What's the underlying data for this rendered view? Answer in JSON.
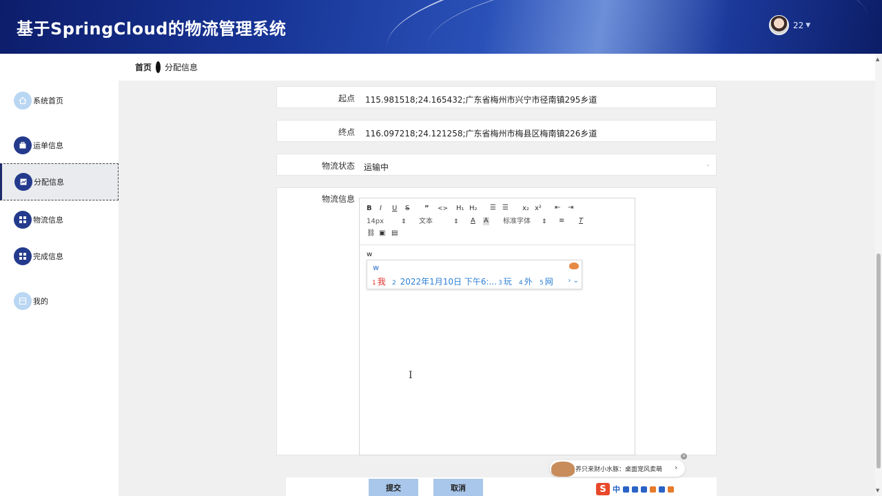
{
  "app": {
    "title": "基于SpringCloud的物流管理系统"
  },
  "user": {
    "name": "22"
  },
  "breadcrumb": {
    "home": "首页",
    "current": "分配信息"
  },
  "sidebar": {
    "items": [
      {
        "label": "系统首页",
        "icon": "home-icon"
      },
      {
        "label": "运单信息",
        "icon": "briefcase-icon"
      },
      {
        "label": "分配信息",
        "icon": "chart-icon",
        "active": true
      },
      {
        "label": "物流信息",
        "icon": "grid-icon"
      },
      {
        "label": "完成信息",
        "icon": "grid-icon"
      },
      {
        "label": "我的",
        "icon": "profile-icon"
      }
    ]
  },
  "form": {
    "start": {
      "label": "起点",
      "value": "115.981518;24.165432;广东省梅州市兴宁市径南镇295乡道"
    },
    "end": {
      "label": "终点",
      "value": "116.097218;24.121258;广东省梅州市梅县区梅南镇226乡道"
    },
    "status": {
      "label": "物流状态",
      "value": "运输中"
    },
    "info": {
      "label": "物流信息",
      "content": "w"
    }
  },
  "editor": {
    "toolbar": {
      "bold": "B",
      "italic": "I",
      "underline": "U",
      "strike": "S",
      "quote": "”",
      "code": "<>",
      "h1": "H₁",
      "h2": "H₂",
      "sub": "x₂",
      "sup": "x²",
      "size": "14px",
      "header": "文本",
      "font": "标准字体"
    }
  },
  "ime": {
    "input": "w",
    "candidates": [
      {
        "num": "1",
        "text": "我"
      },
      {
        "num": "2",
        "text": "2022年1月10日 下午6:..."
      },
      {
        "num": "3",
        "text": "玩"
      },
      {
        "num": "4",
        "text": "外"
      },
      {
        "num": "5",
        "text": "网"
      }
    ]
  },
  "buttons": {
    "submit": "提交",
    "cancel": "取消"
  },
  "toast": {
    "text": "养只来财小水豚：桌面宠风卖萌"
  },
  "tray": {
    "zh": "中"
  },
  "colors": {
    "header": "#173495",
    "menu_icon": "#243a8c",
    "button": "#a9c7ea",
    "ime_highlight": "#e0302a"
  }
}
